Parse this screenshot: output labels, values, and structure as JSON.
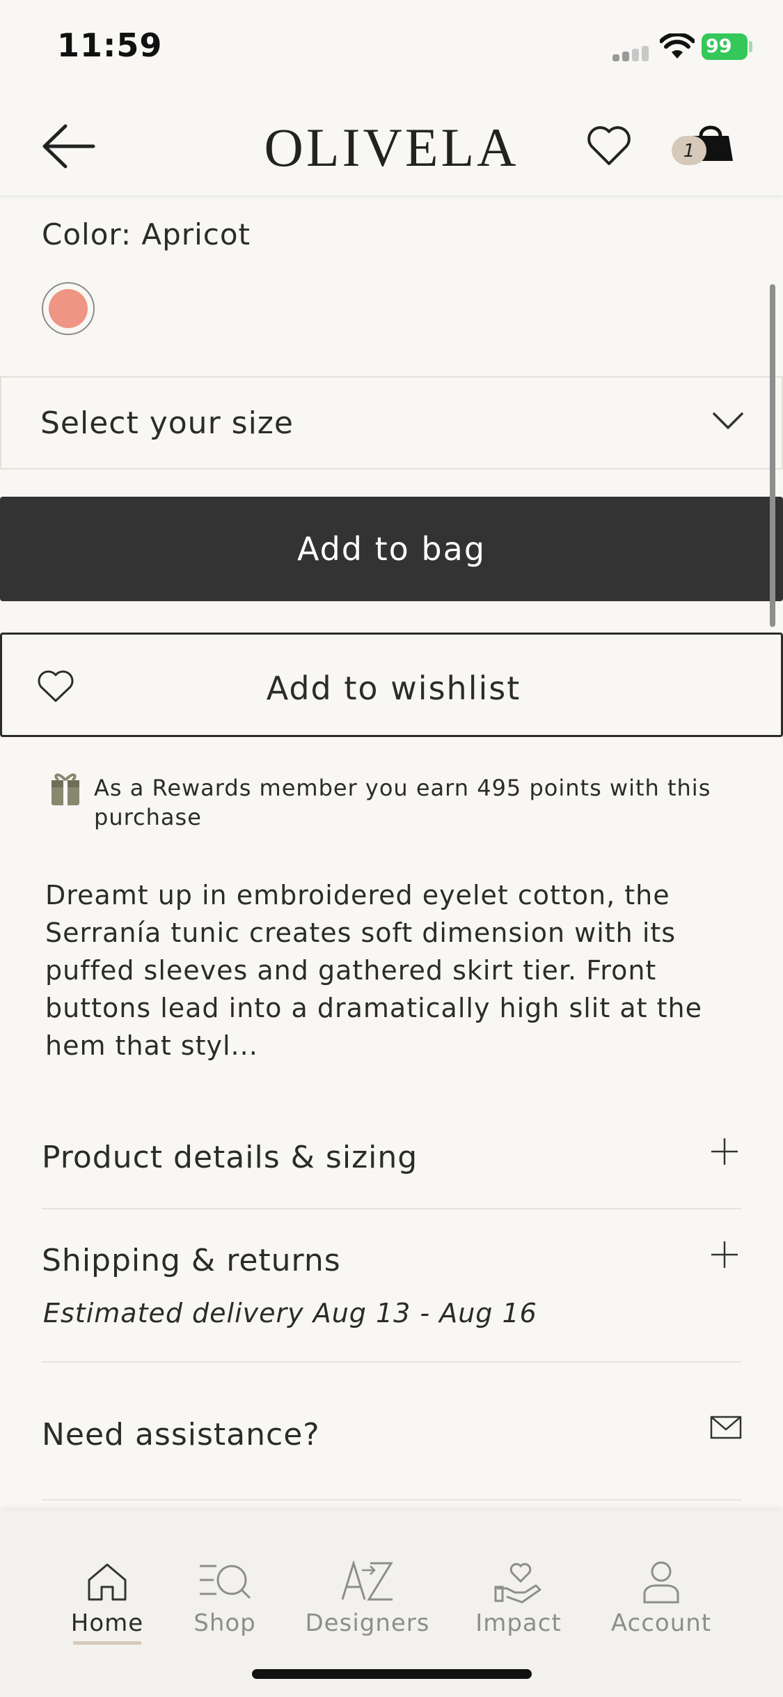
{
  "status_bar": {
    "time": "11:59",
    "battery": "99"
  },
  "header": {
    "logo": "OLIVELA",
    "bag_count": "1"
  },
  "product": {
    "color_label": "Color: Apricot",
    "swatch_color": "#ee9583",
    "size_placeholder": "Select your size",
    "add_to_bag": "Add to bag",
    "add_to_wishlist": "Add to wishlist",
    "rewards_text": "As a Rewards member you earn 495 points with this purchase",
    "description": "Dreamt up in embroidered eyelet cotton, the Serranía tunic creates soft dimension with its puffed sleeves and gathered skirt tier. Front buttons lead into a dramatically high slit at the hem that styl..."
  },
  "accordion": {
    "details": "Product details & sizing",
    "shipping": "Shipping & returns",
    "delivery": "Estimated delivery Aug 13 - Aug 16",
    "assistance": "Need assistance?"
  },
  "tabs": [
    {
      "label": "Home",
      "icon": "home-icon",
      "active": true
    },
    {
      "label": "Shop",
      "icon": "shop-search-icon",
      "active": false
    },
    {
      "label": "Designers",
      "icon": "a-to-z-icon",
      "active": false
    },
    {
      "label": "Impact",
      "icon": "heart-hand-icon",
      "active": false
    },
    {
      "label": "Account",
      "icon": "person-icon",
      "active": false
    }
  ],
  "colors": {
    "background": "#f8f7f4",
    "primary_button": "#333333",
    "accent": "#d6c9b9",
    "battery": "#34c759"
  }
}
